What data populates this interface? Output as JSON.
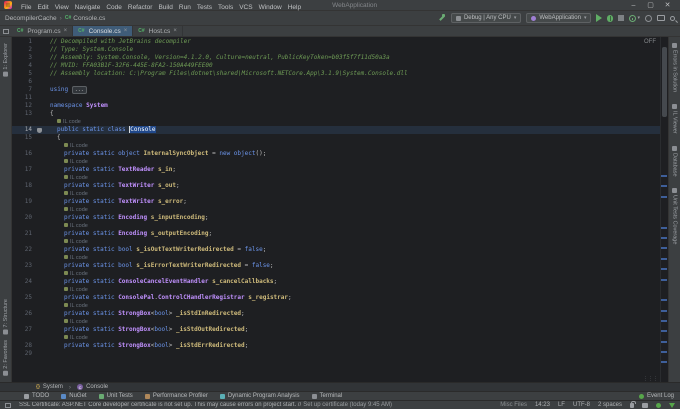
{
  "app": {
    "title": "WebApplication",
    "window_controls": {
      "minimize": "–",
      "maximize": "▢",
      "close": "✕"
    }
  },
  "menu_bar": {
    "items": [
      "File",
      "Edit",
      "View",
      "Navigate",
      "Code",
      "Refactor",
      "Build",
      "Run",
      "Tests",
      "Tools",
      "VCS",
      "Window",
      "Help"
    ]
  },
  "breadcrumb_bar": {
    "items": [
      "DecompilerCache",
      "Console.cs"
    ],
    "separator": "›"
  },
  "run_toolbar": {
    "config_selector": "Debug | Any CPU",
    "target_selector": "WebApplication",
    "dropdown_glyph": "▾"
  },
  "tab_bar": {
    "file_icon_label": "C#",
    "close_glyph": "×",
    "tabs": [
      {
        "label": "Program.cs",
        "active": false
      },
      {
        "label": "Console.cs",
        "active": true
      },
      {
        "label": "Host.cs",
        "active": false
      }
    ]
  },
  "left_tool_bar": {
    "top": [
      {
        "label": "1: Explorer"
      }
    ],
    "bottom": [
      {
        "label": "7: Structure"
      },
      {
        "label": "2: Favorites"
      }
    ]
  },
  "right_tool_bar": {
    "items": [
      {
        "label": "Errors in Solution"
      },
      {
        "label": "IL Viewer"
      },
      {
        "label": "Database"
      },
      {
        "label": "Unit Tests Coverage"
      }
    ]
  },
  "editor": {
    "highlighting_status": "OFF",
    "code_vision_hint": "IL code",
    "fold_placeholder": "...",
    "lines": [
      {
        "n": "1",
        "i": 0,
        "s": [
          [
            "c",
            "// Decompiled with JetBrains decompiler"
          ]
        ]
      },
      {
        "n": "2",
        "i": 0,
        "s": [
          [
            "c",
            "// Type: System.Console"
          ]
        ]
      },
      {
        "n": "3",
        "i": 0,
        "s": [
          [
            "c",
            "// Assembly: System.Console, Version=4.1.2.0, Culture=neutral, PublicKeyToken=b03f5f7f11d50a3a"
          ]
        ]
      },
      {
        "n": "4",
        "i": 0,
        "s": [
          [
            "c",
            "// MVID: FFA03B1F-32F6-445E-8FA2-150A449FEE00"
          ]
        ]
      },
      {
        "n": "5",
        "i": 0,
        "s": [
          [
            "c",
            "// Assembly location: C:\\Program Files\\dotnet\\shared\\Microsoft.NETCore.App\\3.1.9\\System.Console.dll"
          ]
        ]
      },
      {
        "n": "6",
        "i": 0,
        "s": []
      },
      {
        "n": "7",
        "i": 0,
        "s": [
          [
            "k",
            "using "
          ],
          [
            "fold",
            "..."
          ]
        ]
      },
      {
        "n": "11",
        "i": 0,
        "s": []
      },
      {
        "n": "12",
        "i": 0,
        "s": [
          [
            "k",
            "namespace "
          ],
          [
            "t",
            "System"
          ]
        ]
      },
      {
        "n": "13",
        "i": 0,
        "s": [
          [
            "p",
            "{"
          ]
        ]
      },
      {
        "hint": true,
        "i": 1
      },
      {
        "n": "14",
        "i": 1,
        "cur": true,
        "icon": true,
        "s": [
          [
            "k",
            "public static class "
          ],
          [
            "sel",
            "Console"
          ]
        ]
      },
      {
        "n": "15",
        "i": 1,
        "s": [
          [
            "p",
            "{"
          ]
        ]
      },
      {
        "hint": true,
        "i": 2
      },
      {
        "n": "16",
        "i": 2,
        "s": [
          [
            "k",
            "private static object "
          ],
          [
            "f",
            "InternalSyncObject"
          ],
          [
            "p",
            " = "
          ],
          [
            "k",
            "new object"
          ],
          [
            "p",
            "();"
          ]
        ]
      },
      {
        "hint": true,
        "i": 2
      },
      {
        "n": "17",
        "i": 2,
        "s": [
          [
            "k",
            "private static "
          ],
          [
            "t",
            "TextReader"
          ],
          [
            "p",
            " "
          ],
          [
            "f",
            "s_in"
          ],
          [
            "p",
            ";"
          ]
        ]
      },
      {
        "hint": true,
        "i": 2
      },
      {
        "n": "18",
        "i": 2,
        "s": [
          [
            "k",
            "private static "
          ],
          [
            "t",
            "TextWriter"
          ],
          [
            "p",
            " "
          ],
          [
            "f",
            "s_out"
          ],
          [
            "p",
            ";"
          ]
        ]
      },
      {
        "hint": true,
        "i": 2
      },
      {
        "n": "19",
        "i": 2,
        "s": [
          [
            "k",
            "private static "
          ],
          [
            "t",
            "TextWriter"
          ],
          [
            "p",
            " "
          ],
          [
            "f",
            "s_error"
          ],
          [
            "p",
            ";"
          ]
        ]
      },
      {
        "hint": true,
        "i": 2
      },
      {
        "n": "20",
        "i": 2,
        "s": [
          [
            "k",
            "private static "
          ],
          [
            "t",
            "Encoding"
          ],
          [
            "p",
            " "
          ],
          [
            "f",
            "s_inputEncoding"
          ],
          [
            "p",
            ";"
          ]
        ]
      },
      {
        "hint": true,
        "i": 2
      },
      {
        "n": "21",
        "i": 2,
        "s": [
          [
            "k",
            "private static "
          ],
          [
            "t",
            "Encoding"
          ],
          [
            "p",
            " "
          ],
          [
            "f",
            "s_outputEncoding"
          ],
          [
            "p",
            ";"
          ]
        ]
      },
      {
        "hint": true,
        "i": 2
      },
      {
        "n": "22",
        "i": 2,
        "s": [
          [
            "k",
            "private static bool "
          ],
          [
            "f",
            "s_isOutTextWriterRedirected"
          ],
          [
            "p",
            " = "
          ],
          [
            "k",
            "false"
          ],
          [
            "p",
            ";"
          ]
        ]
      },
      {
        "hint": true,
        "i": 2
      },
      {
        "n": "23",
        "i": 2,
        "s": [
          [
            "k",
            "private static bool "
          ],
          [
            "f",
            "s_isErrorTextWriterRedirected"
          ],
          [
            "p",
            " = "
          ],
          [
            "k",
            "false"
          ],
          [
            "p",
            ";"
          ]
        ]
      },
      {
        "hint": true,
        "i": 2
      },
      {
        "n": "24",
        "i": 2,
        "s": [
          [
            "k",
            "private static "
          ],
          [
            "t",
            "ConsoleCancelEventHandler"
          ],
          [
            "p",
            " "
          ],
          [
            "f",
            "s_cancelCallbacks"
          ],
          [
            "p",
            ";"
          ]
        ]
      },
      {
        "hint": true,
        "i": 2
      },
      {
        "n": "25",
        "i": 2,
        "s": [
          [
            "k",
            "private static "
          ],
          [
            "t",
            "ConsolePal"
          ],
          [
            "p",
            "."
          ],
          [
            "t",
            "ControlCHandlerRegistrar"
          ],
          [
            "p",
            " "
          ],
          [
            "f",
            "s_registrar"
          ],
          [
            "p",
            ";"
          ]
        ]
      },
      {
        "hint": true,
        "i": 2
      },
      {
        "n": "26",
        "i": 2,
        "s": [
          [
            "k",
            "private static "
          ],
          [
            "t",
            "StrongBox"
          ],
          [
            "p",
            "<"
          ],
          [
            "k",
            "bool"
          ],
          [
            "p",
            "> "
          ],
          [
            "f",
            "_isStdInRedirected"
          ],
          [
            "p",
            ";"
          ]
        ]
      },
      {
        "hint": true,
        "i": 2
      },
      {
        "n": "27",
        "i": 2,
        "s": [
          [
            "k",
            "private static "
          ],
          [
            "t",
            "StrongBox"
          ],
          [
            "p",
            "<"
          ],
          [
            "k",
            "bool"
          ],
          [
            "p",
            "> "
          ],
          [
            "f",
            "_isStdOutRedirected"
          ],
          [
            "p",
            ";"
          ]
        ]
      },
      {
        "hint": true,
        "i": 2
      },
      {
        "n": "28",
        "i": 2,
        "s": [
          [
            "k",
            "private static "
          ],
          [
            "t",
            "StrongBox"
          ],
          [
            "p",
            "<"
          ],
          [
            "k",
            "bool"
          ],
          [
            "p",
            "> "
          ],
          [
            "f",
            "_isStdErrRedirected"
          ],
          [
            "p",
            ";"
          ]
        ]
      },
      {
        "n": "29",
        "i": 1,
        "s": []
      }
    ]
  },
  "bottom_breadcrumbs": {
    "separator": "›",
    "items": [
      {
        "label": "System"
      },
      {
        "label": "Console"
      }
    ]
  },
  "bottom_tool_bar": {
    "items": [
      {
        "label": "TODO"
      },
      {
        "label": "NuGet"
      },
      {
        "label": "Unit Tests"
      },
      {
        "label": "Performance Profiler"
      },
      {
        "label": "Dynamic Program Analysis"
      },
      {
        "label": "Terminal"
      }
    ],
    "event_log_label": "Event Log"
  },
  "status_bar": {
    "message": "SSL Certificate: ASP.NET Core developer certificate is not set up. This may cause errors on project start. //",
    "action": "Set up certificate (today 9:45 AM)",
    "items": [
      "Misc Files",
      "14:23",
      "LF",
      "UTF-8",
      "2 spaces"
    ]
  },
  "colors": {
    "accent_run_green": "#5fad65",
    "selection_blue": "#21498c",
    "comment_green": "#6e9b55",
    "keyword_blue": "#6c95eb",
    "type_purple": "#c191ff",
    "field_gold": "#d0bc7c"
  },
  "icons": {
    "rider-logo": "gradient-square",
    "build-hammer": "css-hammer",
    "run": "play-triangle",
    "debug": "bug-shape",
    "stop": "gray-square",
    "profiler": "green-dial",
    "coverage": "circle",
    "attach-monitor": "monitor-rect",
    "search-everywhere": "magnifier",
    "csharp-file": "C#",
    "readonly-lock": "lock-shape",
    "event-log": "green-dot"
  }
}
